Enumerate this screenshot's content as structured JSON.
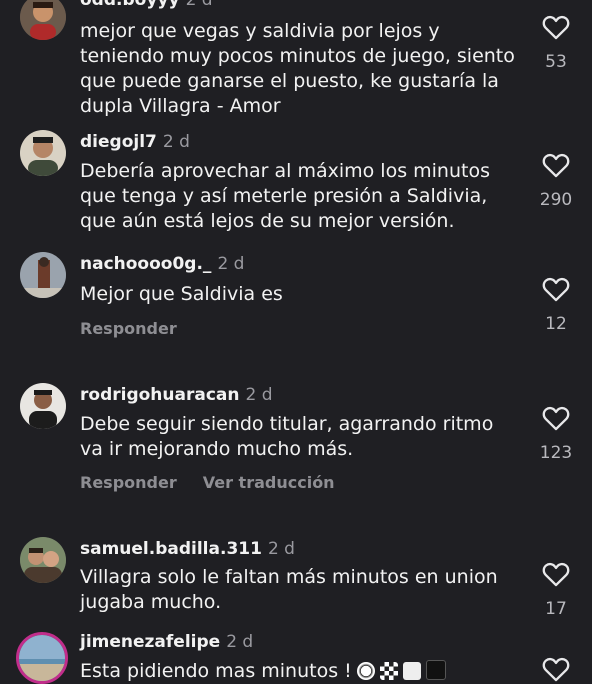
{
  "comments": [
    {
      "username": "odd.boyyy",
      "time": "2 d",
      "text": "mejor que vegas y saldivia por lejos y teniendo muy pocos minutos de juego, siento que puede ganarse el puesto, ke gustaría la dupla Villagra - Amor",
      "likes": "53",
      "avatar": "avatar-photo"
    },
    {
      "username": "diegojl7",
      "time": "2 d",
      "text": "Debería aprovechar al máximo los minutos que tenga y así meterle presión a Saldivia, que aún está lejos de su mejor versión.",
      "likes": "290",
      "avatar": "avatar-photo"
    },
    {
      "username": "nachoooo0g._",
      "time": "2 d",
      "text": "Mejor que Saldivia es",
      "likes": "12",
      "reply_label": "Responder",
      "avatar": "avatar-photo"
    },
    {
      "username": "rodrigohuaracan",
      "time": "2 d",
      "text": "Debe seguir siendo titular, agarrando ritmo va ir mejorando mucho más.",
      "likes": "123",
      "reply_label": "Responder",
      "translate_label": "Ver traducción",
      "avatar": "avatar-photo"
    },
    {
      "username": "samuel.badilla.311",
      "time": "2 d",
      "text": "Villagra solo le faltan más minutos  en union jugaba mucho.",
      "likes": "17",
      "avatar": "avatar-photo"
    },
    {
      "username": "jimenezafelipe",
      "time": "2 d",
      "text": "Esta pidiendo mas minutos !",
      "likes": "",
      "avatar": "avatar-photo-story-ring",
      "emojis": [
        "soccer-ball",
        "checkered-flag",
        "white-flag",
        "black-flag"
      ]
    }
  ],
  "colors": {
    "background": "#1f1f23",
    "text": "#f2f2f2",
    "muted": "#9a9aa0",
    "story_ring": "#c12d8b"
  }
}
